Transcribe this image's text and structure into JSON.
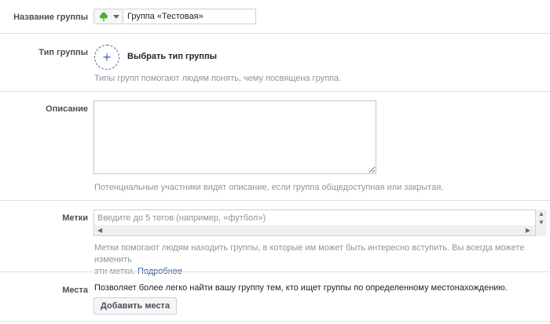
{
  "group_name": {
    "label": "Название группы",
    "value": "Группа «Тестовая»",
    "icon": "tree-icon",
    "icon_color": "#42b72a"
  },
  "group_type": {
    "label": "Тип группы",
    "action_label": "Выбрать тип группы",
    "hint": "Типы групп помогают людям понять, чему посвящена группа."
  },
  "description": {
    "label": "Описание",
    "value": "",
    "hint": "Потенциальные участники видят описание, если группа общедоступная или закрытая."
  },
  "tags": {
    "label": "Метки",
    "placeholder": "Введите до 5 тегов (например, «футбол»)",
    "hint_line1": "Метки помогают людям находить группы, в которые им может быть интересно вступить. Вы всегда можете изменить",
    "hint_line2": "эти метки.",
    "hint_link": "Подробнее"
  },
  "places": {
    "label": "Места",
    "text": "Позволяет более легко найти вашу группу тем, кто ищет группы по определенному местонахождению.",
    "button_label": "Добавить места"
  },
  "colors": {
    "accent": "#4267b2",
    "divider": "#dddfe2",
    "hint_text": "#90949c"
  }
}
